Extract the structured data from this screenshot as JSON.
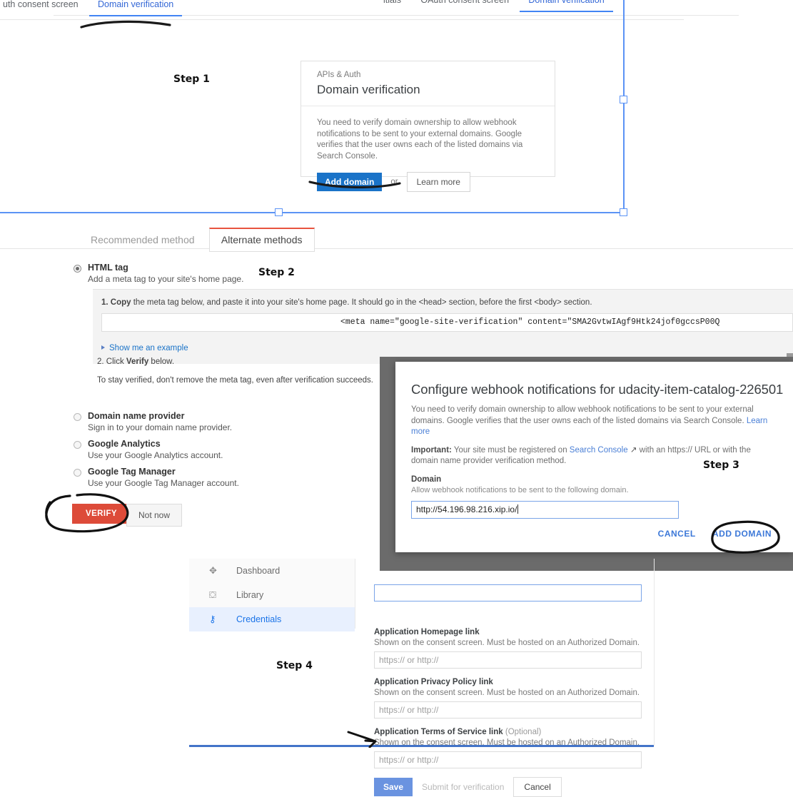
{
  "console_tabs_left": [
    {
      "label": "uth consent screen",
      "active": false
    },
    {
      "label": "Domain verification",
      "active": true
    }
  ],
  "console_tabs_right": [
    {
      "label": "itials",
      "active": false
    },
    {
      "label": "OAuth consent screen",
      "active": false
    },
    {
      "label": "Domain verification",
      "active": true
    }
  ],
  "steps": {
    "one": "Step 1",
    "two": "Step 2",
    "three": "Step 3",
    "four": "Step 4"
  },
  "step1_card": {
    "eyebrow": "APIs & Auth",
    "title": "Domain verification",
    "description": "You need to verify domain ownership to allow webhook notifications to be sent to your external domains. Google verifies that the user owns each of the listed domains via Search Console.",
    "add_domain_label": "Add domain",
    "or_label": "or",
    "learn_more_label": "Learn more"
  },
  "step2_verify": {
    "tabs": [
      {
        "label": "Recommended method",
        "selected": false
      },
      {
        "label": "Alternate methods",
        "selected": true
      }
    ],
    "methods": [
      {
        "title": "HTML tag",
        "subtitle": "Add a meta tag to your site's home page.",
        "selected": true
      },
      {
        "title": "Domain name provider",
        "subtitle": "Sign in to your domain name provider.",
        "selected": false
      },
      {
        "title": "Google Analytics",
        "subtitle": "Use your Google Analytics account.",
        "selected": false
      },
      {
        "title": "Google Tag Manager",
        "subtitle": "Use your Google Tag Manager account.",
        "selected": false
      }
    ],
    "instruction_1_prefix": "1. Copy",
    "instruction_1_rest": " the meta tag below, and paste it into your site's home page. It should go in the <head> section, before the first <body> section.",
    "meta_tag": "<meta name=\"google-site-verification\" content=\"SMA2GvtwIAgf9Htk24jof0gccsP00Q",
    "show_example_label": "Show me an example",
    "instruction_2_prefix": "2. Click ",
    "instruction_2_bold": "Verify",
    "instruction_2_rest": " below.",
    "stay_verified_note": "To stay verified, don't remove the meta tag, even after verification succeeds.",
    "verify_button": "VERIFY",
    "not_now_button": "Not now"
  },
  "step3_modal": {
    "title": "Configure webhook notifications for udacity-item-catalog-226501",
    "paragraph_1": "You need to verify domain ownership to allow webhook notifications to be sent to your external domains. Google verifies that the user owns each of the listed domains via Search Console.",
    "paragraph_1_link": "Learn more",
    "important_label": "Important:",
    "important_text_a": " Your site must be registered on ",
    "important_link": "Search Console",
    "important_text_b": " with an https:// URL or with the domain name provider verification method.",
    "domain_label": "Domain",
    "domain_sub": "Allow webhook notifications to be sent to the following domain.",
    "domain_value": "http://54.196.98.216.xip.io/",
    "cancel_label": "CANCEL",
    "add_domain_label": "ADD DOMAIN"
  },
  "step4": {
    "sidebar": [
      {
        "label": "Dashboard",
        "icon": "dashboard-icon",
        "selected": false
      },
      {
        "label": "Library",
        "icon": "library-icon",
        "selected": false
      },
      {
        "label": "Credentials",
        "icon": "key-icon",
        "selected": true
      }
    ],
    "fields": [
      {
        "label": "Application Homepage link",
        "optional": "",
        "sub": "Shown on the consent screen. Must be hosted on an Authorized Domain.",
        "placeholder": "https:// or http://",
        "value": ""
      },
      {
        "label": "Application Privacy Policy link",
        "optional": "",
        "sub": "Shown on the consent screen. Must be hosted on an Authorized Domain.",
        "placeholder": "https:// or http://",
        "value": ""
      },
      {
        "label": "Application Terms of Service link",
        "optional": "(Optional)",
        "sub": "Shown on the consent screen. Must be hosted on an Authorized Domain.",
        "placeholder": "https:// or http://",
        "value": ""
      }
    ],
    "save_label": "Save",
    "submit_label": "Submit for verification",
    "cancel_label": "Cancel"
  },
  "colors": {
    "google_blue": "#1a73c8",
    "tab_blue": "#4285f4",
    "verify_red": "#dd4b39",
    "tab_red": "#e8543f",
    "link_blue": "#4a7fd6",
    "selection_blue": "#5b93f5",
    "scrim_gray": "#6b6b6b"
  }
}
